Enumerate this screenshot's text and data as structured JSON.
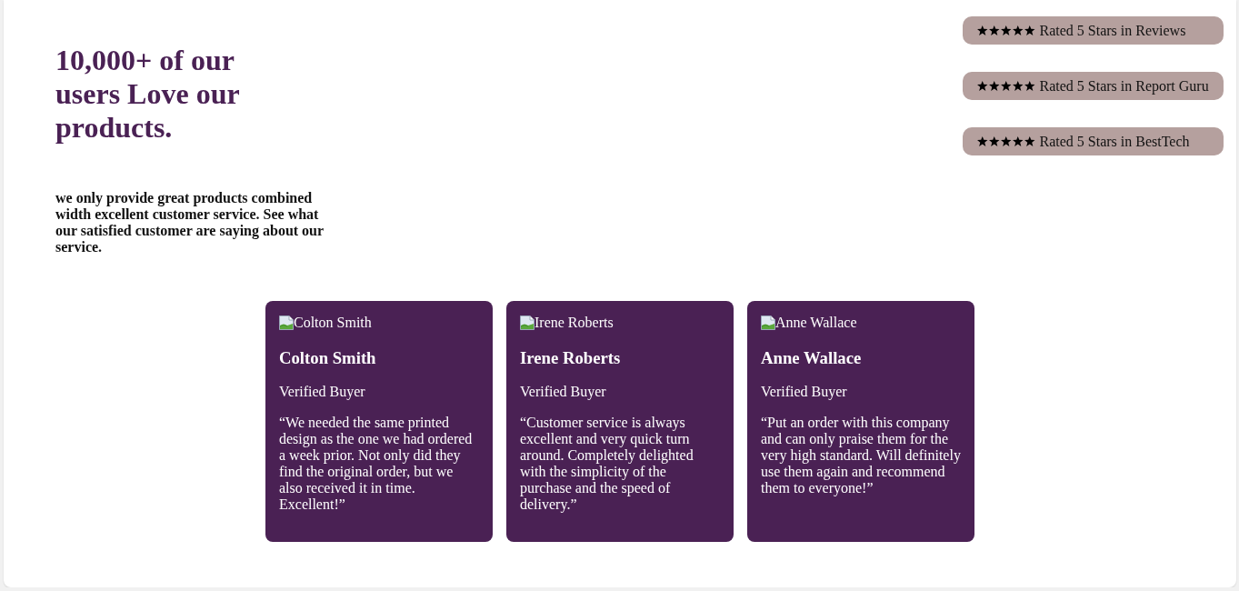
{
  "headline": "10,000+ of our users Love our products.",
  "intro": "we only provide great products combined width excellent customer service. See what our satisfied customer are saying about our service.",
  "ratings": [
    {
      "stars": 5,
      "label": "Rated 5 Stars in Reviews"
    },
    {
      "stars": 5,
      "label": "Rated 5 Stars in Report Guru"
    },
    {
      "stars": 5,
      "label": "Rated 5 Stars in BestTech"
    }
  ],
  "testimonials": [
    {
      "image_alt": "Colton Smith",
      "name": "Colton Smith",
      "badge": "Verified Buyer",
      "quote": "“We needed the same printed design as the one we had ordered a week prior. Not only did they find the original order, but we also received it in time. Excellent!”"
    },
    {
      "image_alt": "Irene Roberts",
      "name": "Irene Roberts",
      "badge": "Verified Buyer",
      "quote": "“Customer service is always excellent and very quick turn around. Completely delighted with the simplicity of the purchase and the speed of delivery.”"
    },
    {
      "image_alt": "Anne Wallace",
      "name": "Anne Wallace",
      "badge": "Verified Buyer",
      "quote": "“Put an order with this company and can only praise them for the very high standard. Will definitely use them again and recommend them to everyone!”"
    }
  ]
}
